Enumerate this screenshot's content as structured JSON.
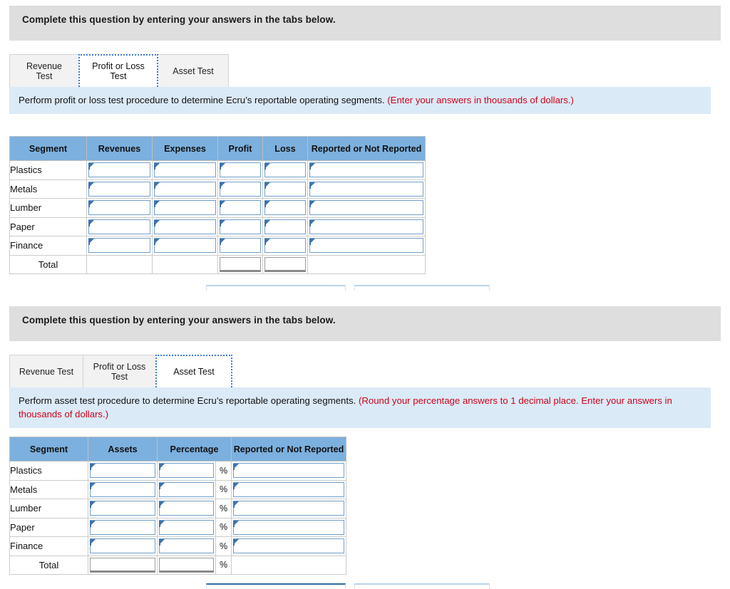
{
  "sections": [
    {
      "banner_text": "Complete this question by entering your answers in the tabs below.",
      "tabs": [
        {
          "label": "Revenue Test",
          "active": false
        },
        {
          "label": "Profit or Loss Test",
          "active": true
        },
        {
          "label": "Asset Test",
          "active": false
        }
      ],
      "instruction": {
        "main": "Perform profit or loss test procedure to determine Ecru’s reportable operating segments.",
        "note": "(Enter your answers in thousands of dollars.)"
      },
      "table": {
        "headers": [
          "Segment",
          "Revenues",
          "Expenses",
          "Profit",
          "Loss",
          "Reported or Not Reported"
        ],
        "rows": [
          "Plastics",
          "Metals",
          "Lumber",
          "Paper",
          "Finance"
        ],
        "total_label": "Total"
      }
    },
    {
      "banner_text": "Complete this question by entering your answers in the tabs below.",
      "tabs": [
        {
          "label": "Revenue Test",
          "active": false
        },
        {
          "label": "Profit or Loss Test",
          "active": false
        },
        {
          "label": "Asset Test",
          "active": true
        }
      ],
      "instruction": {
        "main": "Perform asset test procedure to determine Ecru’s reportable operating segments.",
        "note": "(Round your percentage answers to 1 decimal place. Enter your answers in thousands of dollars.)"
      },
      "table": {
        "headers": [
          "Segment",
          "Assets",
          "Percentage",
          "Reported or Not Reported"
        ],
        "rows": [
          "Plastics",
          "Metals",
          "Lumber",
          "Paper",
          "Finance"
        ],
        "total_label": "Total",
        "percent_symbol": "%"
      }
    }
  ],
  "colors": {
    "header_blue": "#7cb0de",
    "panel_blue": "#dbeaf7",
    "banner_gray": "#dedede",
    "note_red": "#d0021b",
    "input_border": "#6f9fcc",
    "focus_outline": "#3b7dd8"
  }
}
